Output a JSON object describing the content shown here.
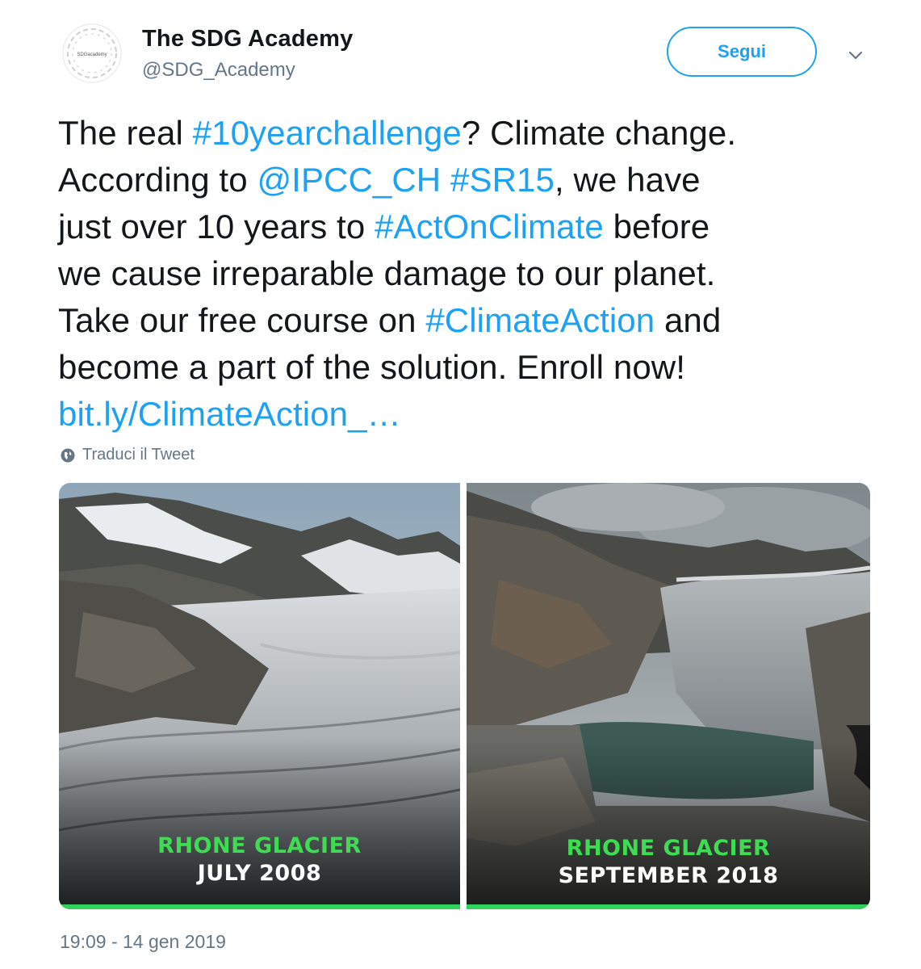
{
  "account": {
    "display_name": "The SDG Academy",
    "handle": "@SDG_Academy",
    "avatar_text": "SDGacademy"
  },
  "follow_button": {
    "label": "Segui"
  },
  "tweet": {
    "lines": [
      [
        {
          "t": "The real ",
          "link": false
        },
        {
          "t": "#10yearchallenge",
          "link": true
        },
        {
          "t": "? Climate change.",
          "link": false
        }
      ],
      [
        {
          "t": "According to ",
          "link": false
        },
        {
          "t": "@IPCC_CH",
          "link": true
        },
        {
          "t": " ",
          "link": false
        },
        {
          "t": "#SR15",
          "link": true
        },
        {
          "t": ", we have",
          "link": false
        }
      ],
      [
        {
          "t": "just over 10 years to ",
          "link": false
        },
        {
          "t": "#ActOnClimate",
          "link": true
        },
        {
          "t": " before",
          "link": false
        }
      ],
      [
        {
          "t": "we cause irreparable damage to our planet.",
          "link": false
        }
      ],
      [
        {
          "t": "Take our free course on ",
          "link": false
        },
        {
          "t": "#ClimateAction",
          "link": true
        },
        {
          "t": " and",
          "link": false
        }
      ],
      [
        {
          "t": "become a part of the solution. Enroll now!",
          "link": false
        }
      ],
      [
        {
          "t": "bit.ly/ClimateAction_…",
          "link": true
        }
      ]
    ]
  },
  "translate": {
    "label": "Traduci il Tweet",
    "icon": "globe-icon"
  },
  "media": {
    "left": {
      "title": "RHONE GLACIER",
      "date": "JULY 2008"
    },
    "right": {
      "title": "RHONE GLACIER",
      "date": "SEPTEMBER 2018"
    }
  },
  "timestamp": "19:09 - 14 gen 2019",
  "colors": {
    "link": "#1da1f2",
    "text": "#14171a",
    "muted": "#657786",
    "caption_green": "#3ddc52"
  }
}
